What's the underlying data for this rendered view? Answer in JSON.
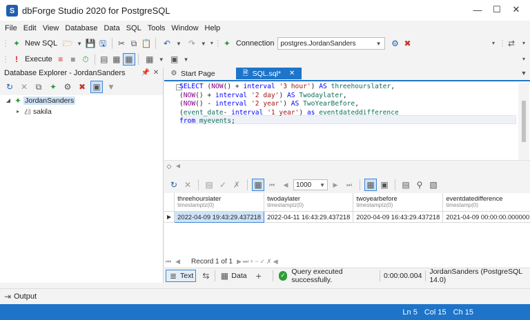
{
  "app": {
    "title": "dbForge Studio 2020 for PostgreSQL",
    "logo_letter": "S"
  },
  "menu": [
    "File",
    "Edit",
    "View",
    "Database",
    "Data",
    "SQL",
    "Tools",
    "Window",
    "Help"
  ],
  "toolbar": {
    "new_sql_label": "New SQL",
    "connection_label": "Connection",
    "connection_value": "postgres.JordanSanders",
    "execute_label": "Execute"
  },
  "explorer": {
    "title": "Database Explorer - JordanSanders",
    "tree": [
      {
        "label": "JordanSanders",
        "expanded": true
      },
      {
        "label": "sakila",
        "expanded": false
      }
    ]
  },
  "tabs": [
    {
      "label": "Start Page",
      "active": false
    },
    {
      "label": "SQL.sql*",
      "active": true
    }
  ],
  "editor": {
    "lines": [
      "SELECT (NOW() + interval '3 hour') AS threehourslater,",
      "(NOW() + interval '2 day') AS Twodaylater,",
      "(NOW() - interval '2 year') AS TwoYearBefore,",
      "(event_date- interval '1 year') as eventdateddifference",
      "from myevents;"
    ]
  },
  "results": {
    "page_size": "1000",
    "columns": [
      {
        "name": "threehourslater",
        "type": "timestamptz(0)"
      },
      {
        "name": "twodaylater",
        "type": "timestamptz(0)"
      },
      {
        "name": "twoyearbefore",
        "type": "timestamptz(0)"
      },
      {
        "name": "eventdatedifference",
        "type": "timestamp(0)"
      }
    ],
    "rows": [
      [
        "2022-04-09 19:43:29.437218",
        "2022-04-11 16:43:29.437218",
        "2020-04-09 16:43:29.437218",
        "2021-04-09 00:00:00.000000"
      ]
    ],
    "record_nav": "Record 1 of 1",
    "text_tab": "Text",
    "data_tab": "Data",
    "status_message": "Query executed successfully.",
    "elapsed": "0:00:00.004",
    "connection_info": "JordanSanders (PostgreSQL 14.0)"
  },
  "output_label": "Output",
  "statusbar": {
    "ln": "Ln 5",
    "col": "Col 15",
    "ch": "Ch 15"
  },
  "colors": {
    "accent": "#1e74c9",
    "keyword": "#0000ff",
    "function": "#8b008b",
    "string": "#a31515",
    "success": "#2e9d3a"
  }
}
